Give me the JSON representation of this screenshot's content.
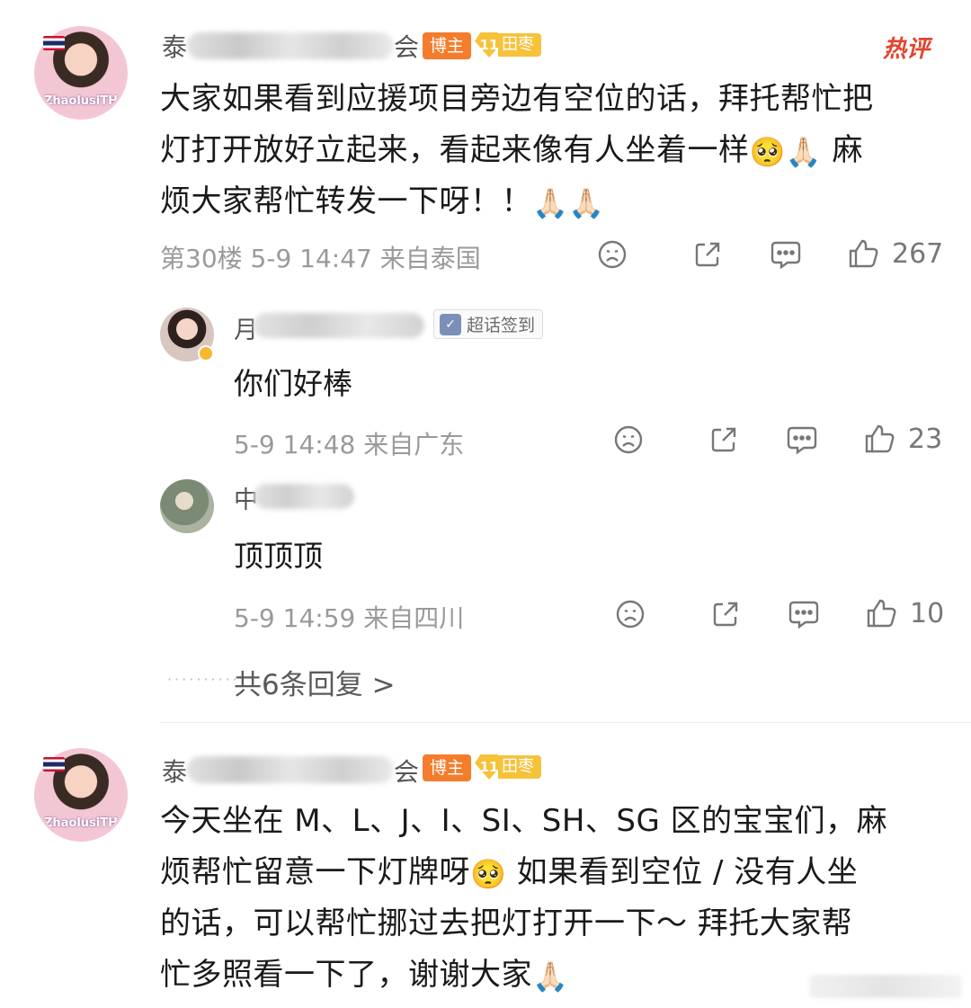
{
  "comment1": {
    "avatar_text": "ZhaolusiTH",
    "name_prefix": "泰",
    "name_suffix": "会",
    "badge_boss": "博主",
    "badge_level": "11",
    "badge_level_text": "田枣",
    "hot_label": "热评",
    "text_line1": "大家如果看到应援项目旁边有空位的话，拜托帮忙把",
    "text_line2": "灯打开放好立起来，看起来像有人坐着一样",
    "text_line2_emoji": "🥺🙏🏻",
    "text_line2_end": " 麻",
    "text_line3": "烦大家帮忙转发一下呀！！",
    "text_line3_emoji": "🙏🏻🙏🏻",
    "meta": "第30楼 5-9 14:47 来自泰国",
    "like_count": "267"
  },
  "reply1": {
    "name_prefix": "月",
    "badge": "超话签到",
    "text": "你们好棒",
    "meta": "5-9 14:48 来自广东",
    "like_count": "23"
  },
  "reply2": {
    "name_prefix": "中",
    "text": "顶顶顶",
    "meta": "5-9 14:59 来自四川",
    "like_count": "10"
  },
  "more_replies": "共6条回复 >",
  "comment2": {
    "avatar_text": "ZhaolusiTH",
    "name_prefix": "泰",
    "name_suffix": "会",
    "badge_boss": "博主",
    "badge_level": "11",
    "badge_level_text": "田枣",
    "text_line1": "今天坐在 M、L、J、I、SI、SH、SG 区的宝宝们，麻",
    "text_line2": "烦帮忙留意一下灯牌呀",
    "text_line2_emoji": "🥺",
    "text_line2_end": " 如果看到空位 / 没有人坐",
    "text_line3": "的话，可以帮忙挪过去把灯打开一下～ 拜托大家帮",
    "text_line4": "忙多照看一下了，谢谢大家",
    "text_line4_emoji": "🙏🏻"
  }
}
